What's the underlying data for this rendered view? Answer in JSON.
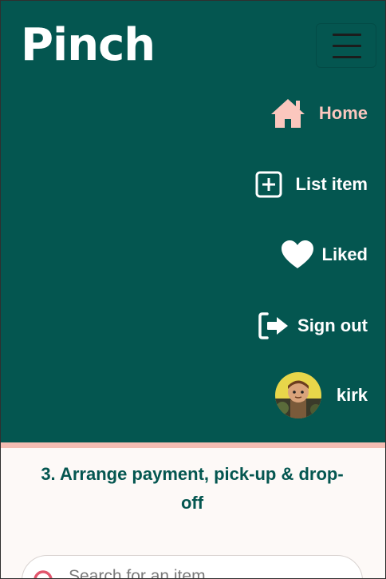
{
  "brand": {
    "name": "Pinch"
  },
  "nav": {
    "toggle_label": "Toggle navigation",
    "items": [
      {
        "label": "Home",
        "icon": "home-icon",
        "active": true
      },
      {
        "label": "List item",
        "icon": "plus-square-icon",
        "active": false
      },
      {
        "label": "Liked",
        "icon": "heart-icon",
        "active": false
      },
      {
        "label": "Sign out",
        "icon": "sign-out-icon",
        "active": false
      },
      {
        "label": "kirk",
        "icon": "avatar",
        "active": false
      }
    ]
  },
  "main": {
    "step_title": "3. Arrange payment, pick-up & drop-off"
  },
  "search": {
    "placeholder": "Search for an item..."
  },
  "colors": {
    "navbar_bg": "#045650",
    "accent_pink": "#fbc7be",
    "divider": "#f4bdb3",
    "page_bg": "#fdf9f7",
    "heading_text": "#045650"
  }
}
